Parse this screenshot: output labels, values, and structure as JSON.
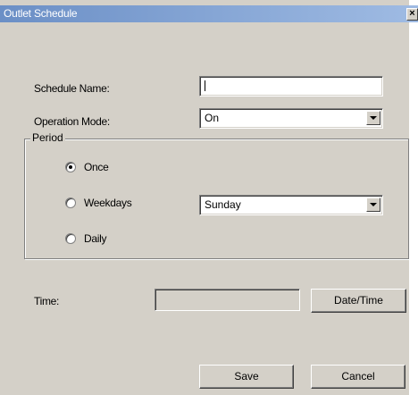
{
  "window": {
    "title": "Outlet Schedule",
    "close_glyph": "×"
  },
  "schedule_name": {
    "label": "Schedule Name:",
    "value": ""
  },
  "operation_mode": {
    "label": "Operation Mode:",
    "selected": "On"
  },
  "period": {
    "legend": "Period",
    "options": [
      {
        "label": "Once",
        "checked": true
      },
      {
        "label": "Weekdays",
        "checked": false
      },
      {
        "label": "Daily",
        "checked": false
      }
    ],
    "weekday_selected": "Sunday"
  },
  "time": {
    "label": "Time:",
    "value": "",
    "datetime_button": "Date/Time"
  },
  "footer": {
    "save_label": "Save",
    "cancel_label": "Cancel"
  },
  "colors": {
    "dialog_bg": "#d4d0c8",
    "titlebar_start": "#6b8fc6",
    "titlebar_end": "#9fbbe3"
  },
  "icons": {
    "close": "close-icon",
    "dropdown": "chevron-down-icon",
    "radio": "radio-icon"
  }
}
